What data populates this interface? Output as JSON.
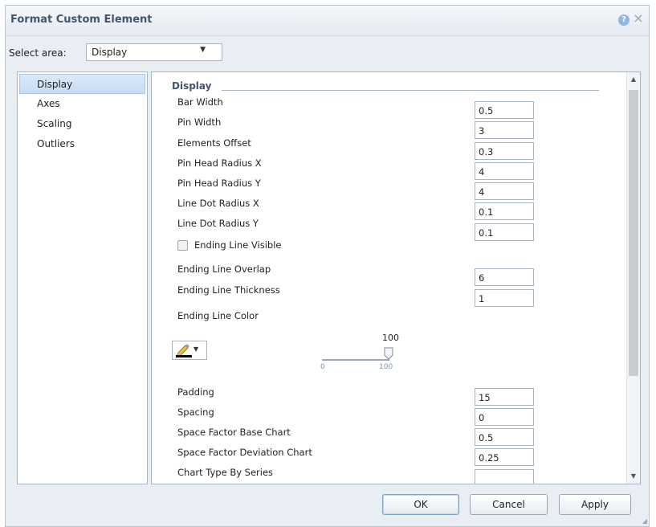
{
  "dialog": {
    "title": "Format Custom Element",
    "help_symbol": "?",
    "close_symbol": "×"
  },
  "select_area": {
    "label": "Select area:",
    "value": "Display"
  },
  "nav": {
    "items": [
      {
        "label": "Display",
        "active": true
      },
      {
        "label": "Axes",
        "active": false
      },
      {
        "label": "Scaling",
        "active": false
      },
      {
        "label": "Outliers",
        "active": false
      }
    ]
  },
  "panel": {
    "section_title": "Display",
    "fields": [
      {
        "label": "Bar Width",
        "value": "0.5"
      },
      {
        "label": "Pin Width",
        "value": "3"
      },
      {
        "label": "Elements Offset",
        "value": "0.3"
      },
      {
        "label": "Pin Head Radius X",
        "value": "4"
      },
      {
        "label": "Pin Head Radius Y",
        "value": "4"
      },
      {
        "label": "Line Dot Radius X",
        "value": "0.1"
      },
      {
        "label": "Line Dot Radius Y",
        "value": "0.1"
      }
    ],
    "checkbox": {
      "label": "Ending Line Visible",
      "checked": false
    },
    "fields2": [
      {
        "label": "Ending Line Overlap",
        "value": "6"
      },
      {
        "label": "Ending Line Thickness",
        "value": "1"
      }
    ],
    "color": {
      "label": "Ending Line Color",
      "swatch": "#000000",
      "pen_icon": "pen-icon"
    },
    "transparency_slider": {
      "value": "100",
      "min": "0",
      "max": "100"
    },
    "fields3": [
      {
        "label": "Padding",
        "value": "15"
      },
      {
        "label": "Spacing",
        "value": "0"
      },
      {
        "label": "Space Factor Base Chart",
        "value": "0.5"
      },
      {
        "label": "Space Factor Deviation Chart",
        "value": "0.25"
      },
      {
        "label": "Chart Type By Series",
        "value": ""
      }
    ]
  },
  "buttons": {
    "ok": "OK",
    "cancel": "Cancel",
    "apply": "Apply"
  }
}
